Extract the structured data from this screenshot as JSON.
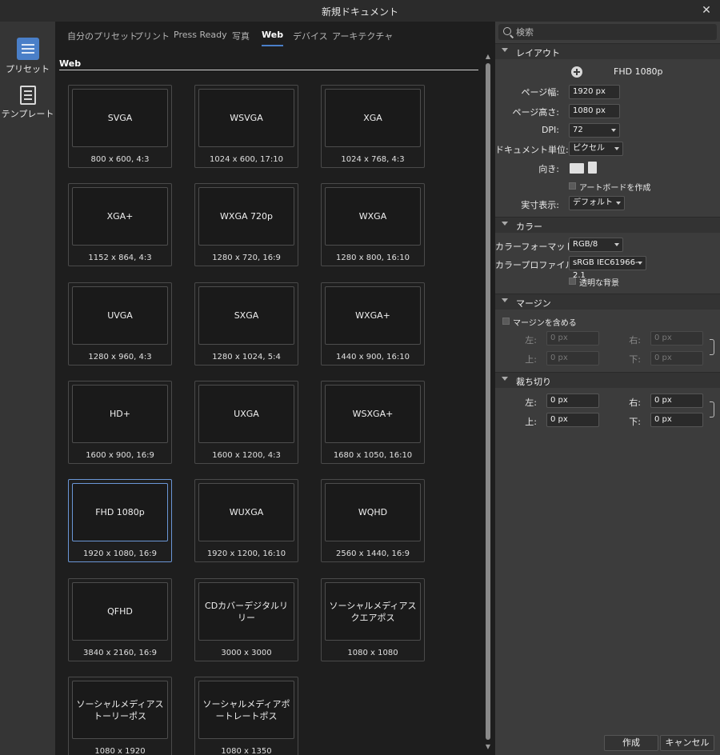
{
  "window": {
    "title": "新規ドキュメント"
  },
  "left_rail": {
    "preset_label": "プリセット",
    "template_label": "テンプレート"
  },
  "tabs": [
    {
      "label": "自分のプリセット"
    },
    {
      "label": "プリント"
    },
    {
      "label": "Press Ready"
    },
    {
      "label": "写真"
    },
    {
      "label": "Web",
      "active": true
    },
    {
      "label": "デバイス"
    },
    {
      "label": "アーキテクチャ"
    }
  ],
  "section_title": "Web",
  "presets": [
    {
      "name": "SVGA",
      "size": "800 x 600, 4:3"
    },
    {
      "name": "WSVGA",
      "size": "1024 x 600, 17:10"
    },
    {
      "name": "XGA",
      "size": "1024 x 768, 4:3"
    },
    {
      "name": "XGA+",
      "size": "1152 x 864, 4:3"
    },
    {
      "name": "WXGA 720p",
      "size": "1280 x 720, 16:9"
    },
    {
      "name": "WXGA",
      "size": "1280 x 800, 16:10"
    },
    {
      "name": "UVGA",
      "size": "1280 x 960, 4:3"
    },
    {
      "name": "SXGA",
      "size": "1280 x 1024, 5:4"
    },
    {
      "name": "WXGA+",
      "size": "1440 x 900, 16:10"
    },
    {
      "name": "HD+",
      "size": "1600 x 900, 16:9"
    },
    {
      "name": "UXGA",
      "size": "1600 x 1200, 4:3"
    },
    {
      "name": "WSXGA+",
      "size": "1680 x 1050, 16:10"
    },
    {
      "name": "FHD 1080p",
      "size": "1920 x 1080, 16:9",
      "selected": true
    },
    {
      "name": "WUXGA",
      "size": "1920 x 1200, 16:10"
    },
    {
      "name": "WQHD",
      "size": "2560 x 1440, 16:9"
    },
    {
      "name": "QFHD",
      "size": "3840 x 2160, 16:9"
    },
    {
      "name": "CDカバーデジタルリリー",
      "size": "3000 x 3000"
    },
    {
      "name": "ソーシャルメディアスクエアポス",
      "size": "1080 x 1080"
    },
    {
      "name": "ソーシャルメディアストーリーポス",
      "size": "1080 x 1920"
    },
    {
      "name": "ソーシャルメディアポートレートポス",
      "size": "1080 x 1350"
    }
  ],
  "panel": {
    "search_placeholder": "検索",
    "layout": {
      "title": "レイアウト",
      "preset_name": "FHD 1080p",
      "page_width_label": "ページ幅:",
      "page_width": "1920 px",
      "page_height_label": "ページ高さ:",
      "page_height": "1080 px",
      "dpi_label": "DPI:",
      "dpi": "72",
      "unit_label": "ドキュメント単位:",
      "unit": "ピクセル",
      "orientation_label": "向き:",
      "artboard_label": "アートボードを作成",
      "display_label": "実寸表示:",
      "display": "デフォルト"
    },
    "color": {
      "title": "カラー",
      "format_label": "カラーフォーマット:",
      "format": "RGB/8",
      "profile_label": "カラープロファイル:",
      "profile": "sRGB IEC61966-2.1",
      "transparent_label": "透明な背景"
    },
    "margin": {
      "title": "マージン",
      "include_label": "マージンを含める",
      "left_label": "左:",
      "left": "0 px",
      "right_label": "右:",
      "right": "0 px",
      "top_label": "上:",
      "top": "0 px",
      "bottom_label": "下:",
      "bottom": "0 px"
    },
    "bleed": {
      "title": "裁ち切り",
      "left_label": "左:",
      "left": "0 px",
      "right_label": "右:",
      "right": "0 px",
      "top_label": "上:",
      "top": "0 px",
      "bottom_label": "下:",
      "bottom": "0 px"
    },
    "create_label": "作成",
    "cancel_label": "キャンセル"
  }
}
